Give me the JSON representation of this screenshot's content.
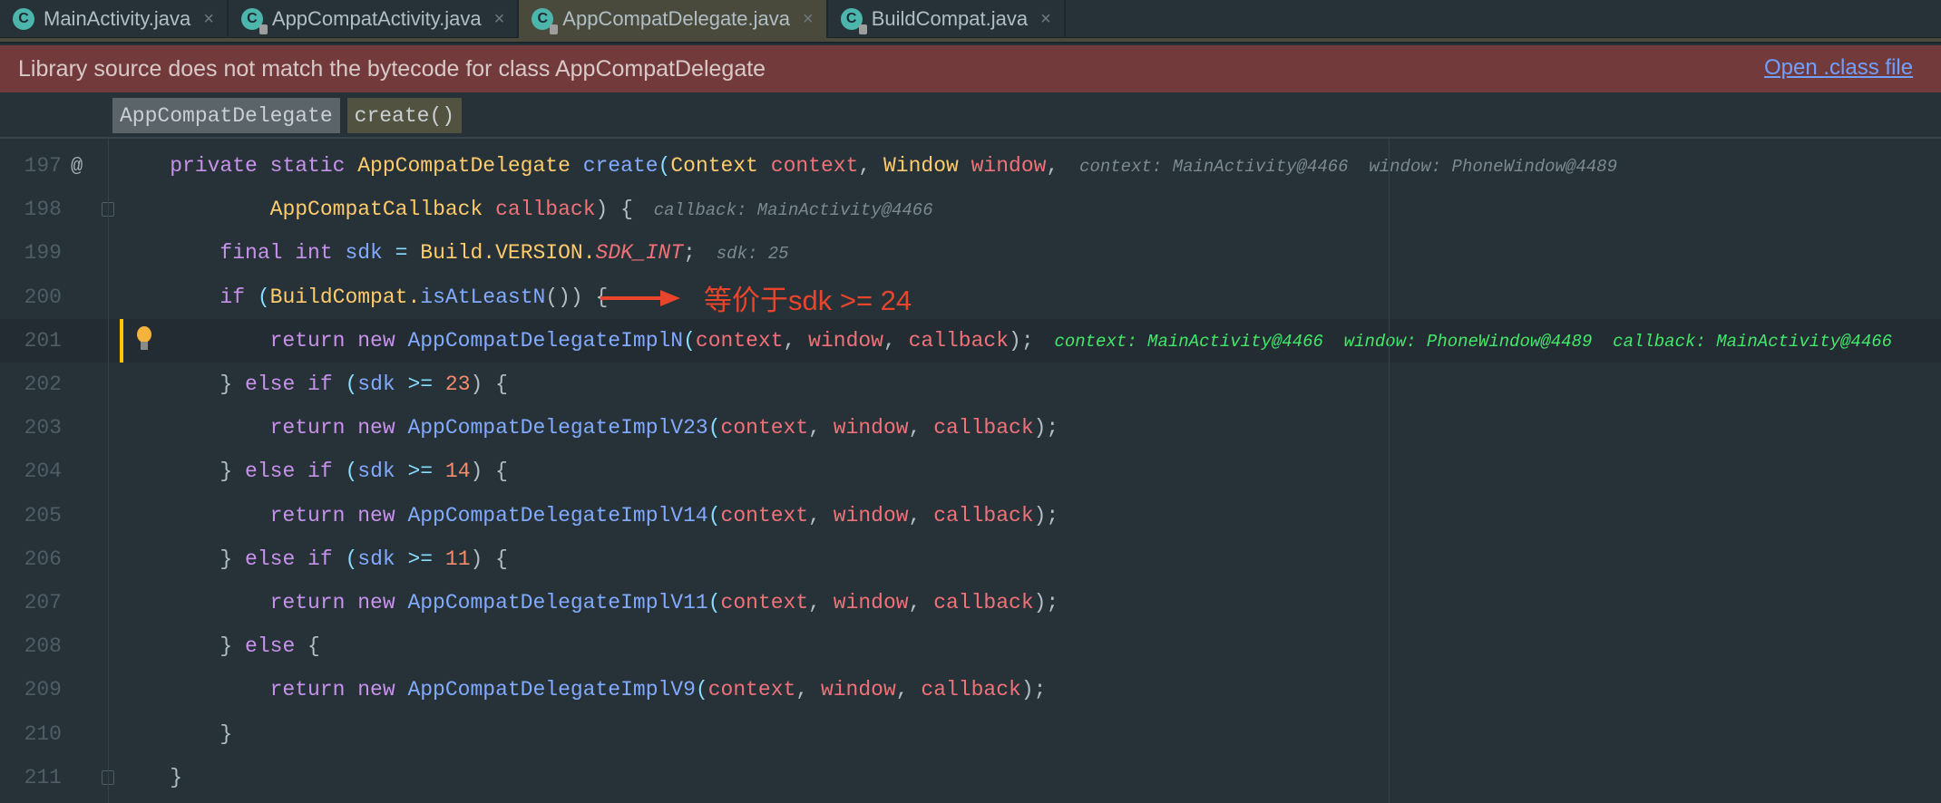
{
  "tabs": [
    {
      "label": "MainActivity.java",
      "locked": false,
      "active": false
    },
    {
      "label": "AppCompatActivity.java",
      "locked": true,
      "active": false
    },
    {
      "label": "AppCompatDelegate.java",
      "locked": true,
      "active": true
    },
    {
      "label": "BuildCompat.java",
      "locked": true,
      "active": false
    }
  ],
  "tab_icon_letter": "C",
  "tab_close": "×",
  "banner": {
    "message": "Library source does not match the bytecode for class AppCompatDelegate",
    "link": "Open .class file"
  },
  "breadcrumbs": [
    {
      "label": "AppCompatDelegate",
      "color": "#5b6468"
    },
    {
      "label": "create()",
      "color": "#525240"
    }
  ],
  "annotation": {
    "text": "等价于sdk >= 24",
    "color": "#e8452c"
  },
  "code": [
    {
      "n": "197",
      "gutter": "@",
      "tokens": [
        [
          "    private static ",
          "k"
        ],
        [
          "AppCompatDelegate ",
          "c"
        ],
        [
          "create",
          "m"
        ],
        [
          "(",
          "o"
        ],
        [
          "Context ",
          "c"
        ],
        [
          "context",
          "p"
        ],
        [
          ", ",
          "d"
        ],
        [
          "Window ",
          "c"
        ],
        [
          "window",
          "p"
        ],
        [
          ",",
          "d"
        ]
      ],
      "hints": [
        "context: MainActivity@4466",
        "window: PhoneWindow@4489"
      ]
    },
    {
      "n": "198",
      "tokens": [
        [
          "            ",
          "d"
        ],
        [
          "AppCompatCallback ",
          "c"
        ],
        [
          "callback",
          "p"
        ],
        [
          ") {",
          "d"
        ]
      ],
      "hints": [
        "callback: MainActivity@4466"
      ]
    },
    {
      "n": "199",
      "tokens": [
        [
          "        final int ",
          "k"
        ],
        [
          "sdk ",
          "m"
        ],
        [
          "= ",
          "o"
        ],
        [
          "Build.VERSION.",
          "c"
        ],
        [
          "SDK_INT",
          "f"
        ],
        [
          ";",
          "d"
        ]
      ],
      "hints": [
        "sdk: 25"
      ]
    },
    {
      "n": "200",
      "tokens": [
        [
          "        if ",
          "k"
        ],
        [
          "(",
          "o"
        ],
        [
          "BuildCompat.",
          "c"
        ],
        [
          "isAtLeastN",
          "m"
        ],
        [
          "()) {",
          "d"
        ]
      ]
    },
    {
      "n": "201",
      "current": true,
      "tokens": [
        [
          "            return new ",
          "k"
        ],
        [
          "AppCompatDelegateImplN",
          "m"
        ],
        [
          "(",
          "o"
        ],
        [
          "context",
          "p"
        ],
        [
          ", ",
          "d"
        ],
        [
          "window",
          "p"
        ],
        [
          ", ",
          "d"
        ],
        [
          "callback",
          "p"
        ],
        [
          ");",
          "d"
        ]
      ],
      "hints": [
        "context: MainActivity@4466",
        "window: PhoneWindow@4489",
        "callback: MainActivity@4466"
      ]
    },
    {
      "n": "202",
      "tokens": [
        [
          "        } ",
          "d"
        ],
        [
          "else if ",
          "k"
        ],
        [
          "(",
          "o"
        ],
        [
          "sdk ",
          "m"
        ],
        [
          ">= ",
          "o"
        ],
        [
          "23",
          "n"
        ],
        [
          ") {",
          "d"
        ]
      ]
    },
    {
      "n": "203",
      "tokens": [
        [
          "            return new ",
          "k"
        ],
        [
          "AppCompatDelegateImplV23",
          "m"
        ],
        [
          "(",
          "o"
        ],
        [
          "context",
          "p"
        ],
        [
          ", ",
          "d"
        ],
        [
          "window",
          "p"
        ],
        [
          ", ",
          "d"
        ],
        [
          "callback",
          "p"
        ],
        [
          ");",
          "d"
        ]
      ]
    },
    {
      "n": "204",
      "tokens": [
        [
          "        } ",
          "d"
        ],
        [
          "else if ",
          "k"
        ],
        [
          "(",
          "o"
        ],
        [
          "sdk ",
          "m"
        ],
        [
          ">= ",
          "o"
        ],
        [
          "14",
          "n"
        ],
        [
          ") {",
          "d"
        ]
      ]
    },
    {
      "n": "205",
      "tokens": [
        [
          "            return new ",
          "k"
        ],
        [
          "AppCompatDelegateImplV14",
          "m"
        ],
        [
          "(",
          "o"
        ],
        [
          "context",
          "p"
        ],
        [
          ", ",
          "d"
        ],
        [
          "window",
          "p"
        ],
        [
          ", ",
          "d"
        ],
        [
          "callback",
          "p"
        ],
        [
          ");",
          "d"
        ]
      ]
    },
    {
      "n": "206",
      "tokens": [
        [
          "        } ",
          "d"
        ],
        [
          "else if ",
          "k"
        ],
        [
          "(",
          "o"
        ],
        [
          "sdk ",
          "m"
        ],
        [
          ">= ",
          "o"
        ],
        [
          "11",
          "n"
        ],
        [
          ") {",
          "d"
        ]
      ]
    },
    {
      "n": "207",
      "tokens": [
        [
          "            return new ",
          "k"
        ],
        [
          "AppCompatDelegateImplV11",
          "m"
        ],
        [
          "(",
          "o"
        ],
        [
          "context",
          "p"
        ],
        [
          ", ",
          "d"
        ],
        [
          "window",
          "p"
        ],
        [
          ", ",
          "d"
        ],
        [
          "callback",
          "p"
        ],
        [
          ");",
          "d"
        ]
      ]
    },
    {
      "n": "208",
      "tokens": [
        [
          "        } ",
          "d"
        ],
        [
          "else ",
          "k"
        ],
        [
          "{",
          "d"
        ]
      ]
    },
    {
      "n": "209",
      "tokens": [
        [
          "            return new ",
          "k"
        ],
        [
          "AppCompatDelegateImplV9",
          "m"
        ],
        [
          "(",
          "o"
        ],
        [
          "context",
          "p"
        ],
        [
          ", ",
          "d"
        ],
        [
          "window",
          "p"
        ],
        [
          ", ",
          "d"
        ],
        [
          "callback",
          "p"
        ],
        [
          ");",
          "d"
        ]
      ]
    },
    {
      "n": "210",
      "tokens": [
        [
          "        }",
          "d"
        ]
      ]
    },
    {
      "n": "211",
      "tokens": [
        [
          "    }",
          "d"
        ]
      ]
    }
  ]
}
